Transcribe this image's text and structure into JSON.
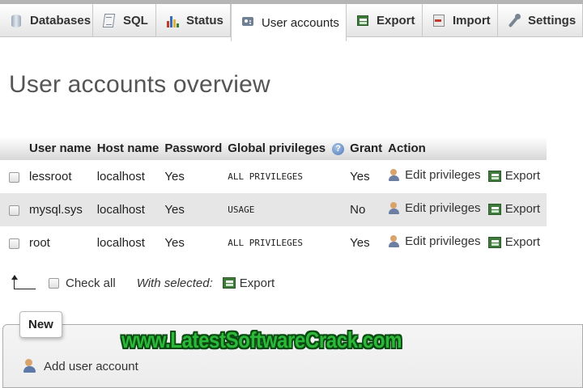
{
  "tabs": [
    {
      "label": "Databases",
      "icon": "database-icon"
    },
    {
      "label": "SQL",
      "icon": "sql-icon"
    },
    {
      "label": "Status",
      "icon": "status-chart-icon"
    },
    {
      "label": "User accounts",
      "icon": "user-accounts-icon",
      "active": true
    },
    {
      "label": "Export",
      "icon": "export-icon"
    },
    {
      "label": "Import",
      "icon": "import-icon"
    },
    {
      "label": "Settings",
      "icon": "wrench-icon"
    }
  ],
  "page_title": "User accounts overview",
  "table": {
    "headers": {
      "user_name": "User name",
      "host_name": "Host name",
      "password": "Password",
      "global_privileges": "Global privileges",
      "grant": "Grant",
      "action": "Action"
    },
    "rows": [
      {
        "user": "lessroot",
        "host": "localhost",
        "password": "Yes",
        "privileges": "ALL PRIVILEGES",
        "grant": "Yes",
        "edit": "Edit privileges",
        "export": "Export"
      },
      {
        "user": "mysql.sys",
        "host": "localhost",
        "password": "Yes",
        "privileges": "USAGE",
        "grant": "No",
        "edit": "Edit privileges",
        "export": "Export"
      },
      {
        "user": "root",
        "host": "localhost",
        "password": "Yes",
        "privileges": "ALL PRIVILEGES",
        "grant": "Yes",
        "edit": "Edit privileges",
        "export": "Export"
      }
    ]
  },
  "bulk": {
    "check_all": "Check all",
    "with_selected": "With selected:",
    "export": "Export"
  },
  "new_section": {
    "legend": "New",
    "add_user": "Add user account"
  },
  "watermark": "www.LatestSoftwareCrack.com",
  "colors": {
    "watermark_green": "#2cb838",
    "row_alt": "#e6e6e6"
  }
}
